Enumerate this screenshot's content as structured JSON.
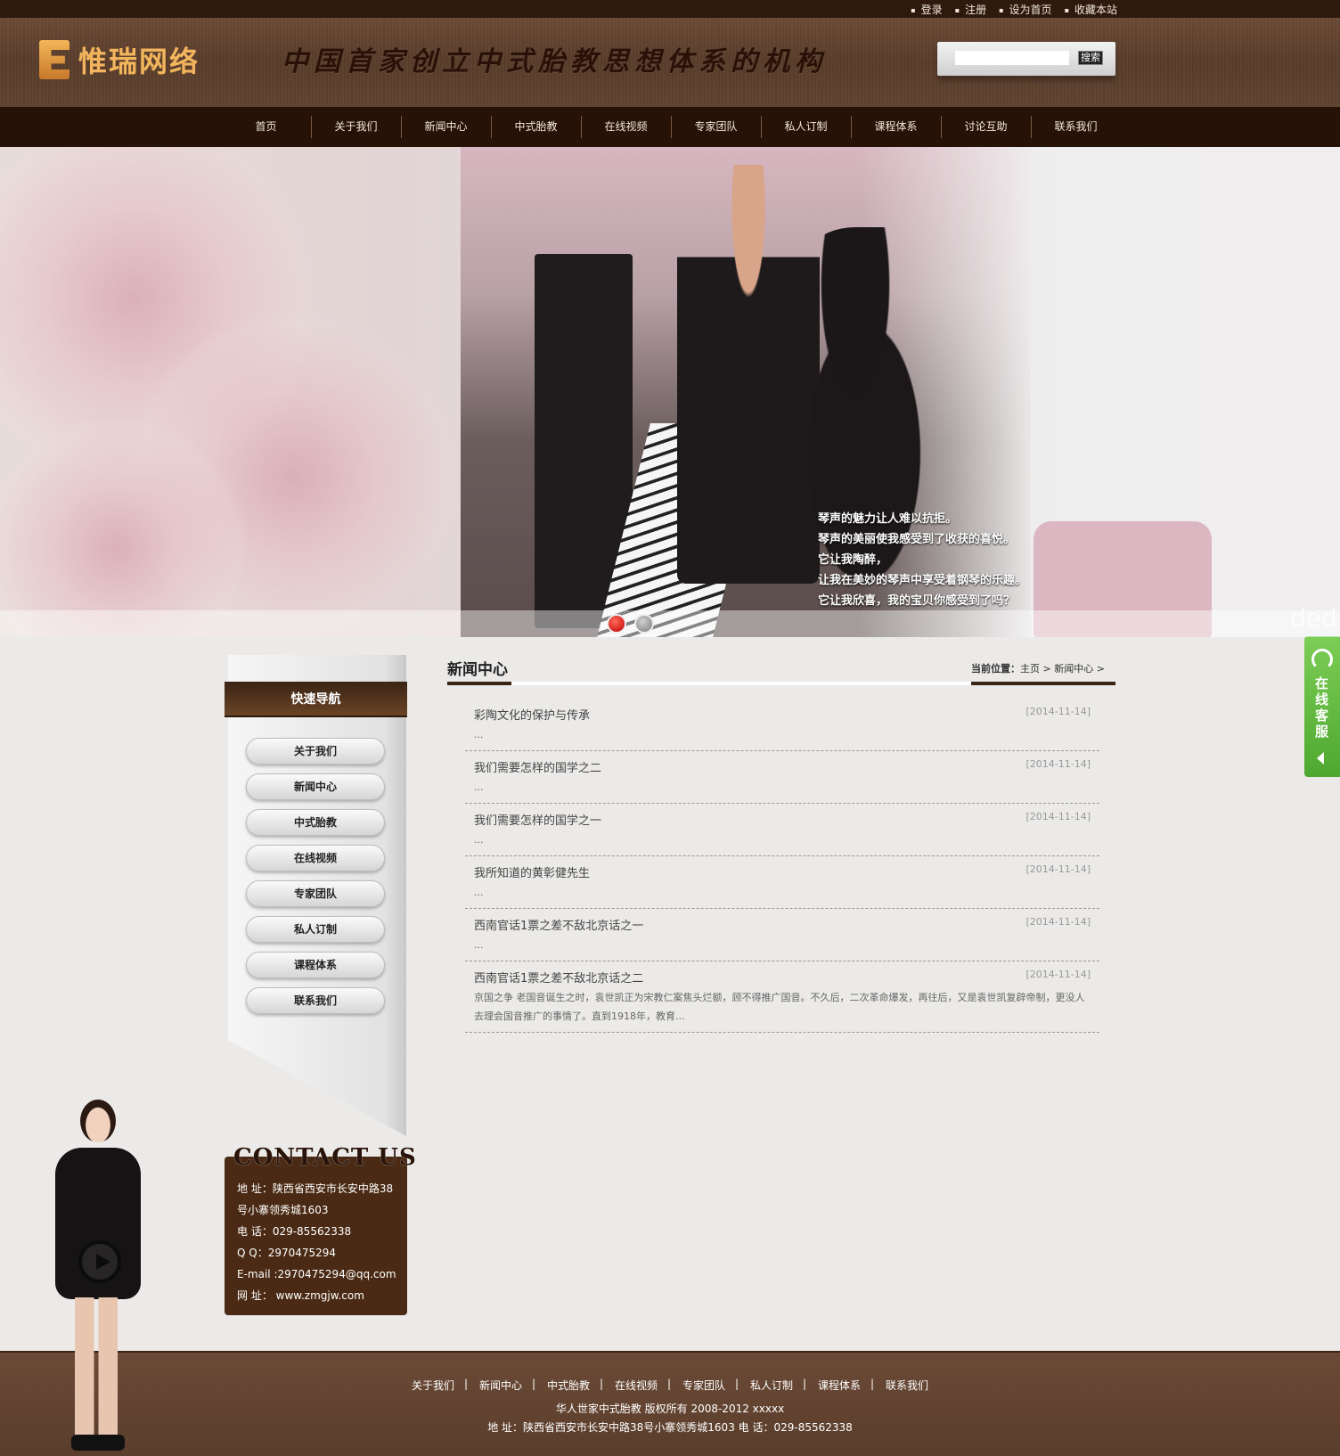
{
  "top_links": [
    "登录",
    "注册",
    "设为首页",
    "收藏本站"
  ],
  "header": {
    "logo_text": "惟瑞网络",
    "slogan": "中国首家创立中式胎教思想体系的机构",
    "search_placeholder": "",
    "search_button": "搜索"
  },
  "nav": [
    "首页",
    "关于我们",
    "新闻中心",
    "中式胎教",
    "在线视频",
    "专家团队",
    "私人订制",
    "课程体系",
    "讨论互助",
    "联系我们"
  ],
  "banner": {
    "caption_lines": [
      "琴声的魅力让人难以抗拒。",
      "琴声的美丽使我感受到了收获的喜悦。",
      "它让我陶醉，",
      "让我在美妙的琴声中享受着钢琴的乐趣。",
      "它让我欣喜，我的宝贝你感受到了吗？"
    ],
    "watermark": "ded",
    "slide_count": 2,
    "active_slide": 1
  },
  "sidebar": {
    "title": "快速导航",
    "items": [
      "关于我们",
      "新闻中心",
      "中式胎教",
      "在线视频",
      "专家团队",
      "私人订制",
      "课程体系",
      "联系我们"
    ]
  },
  "contact": {
    "title": "CONTACT US",
    "lines": [
      "地  址：陕西省西安市长安中路38",
      "号小寨领秀城1603",
      "电  话：029-85562338",
      "Q  Q：2970475294",
      "E-mail :2970475294@qq.com",
      "网  址： www.zmgjw.com"
    ]
  },
  "main": {
    "title": "新闻中心",
    "breadcrumb_label": "当前位置：",
    "breadcrumb_home": "主页",
    "breadcrumb_sep": ">",
    "breadcrumb_current": "新闻中心",
    "breadcrumb_tail": ">"
  },
  "news": [
    {
      "title": "彩陶文化的保护与传承",
      "date": "[2014-11-14]",
      "desc": "..."
    },
    {
      "title": "我们需要怎样的国学之二",
      "date": "[2014-11-14]",
      "desc": "..."
    },
    {
      "title": "我们需要怎样的国学之一",
      "date": "[2014-11-14]",
      "desc": "..."
    },
    {
      "title": "我所知道的黄彰健先生",
      "date": "[2014-11-14]",
      "desc": "..."
    },
    {
      "title": "西南官话1票之差不敌北京话之一",
      "date": "[2014-11-14]",
      "desc": "..."
    },
    {
      "title": "西南官话1票之差不敌北京话之二",
      "date": "[2014-11-14]",
      "desc": "京国之争 老国音诞生之时，袁世凯正为宋教仁案焦头烂额，顾不得推广国音。不久后，二次革命爆发，再往后，又是袁世凯复辟帝制，更没人去理会国音推广的事情了。直到1918年，教育..."
    }
  ],
  "service_tab": {
    "label": "在线客服"
  },
  "footer": {
    "links": [
      "关于我们",
      "新闻中心",
      "中式胎教",
      "在线视频",
      "专家团队",
      "私人订制",
      "课程体系",
      "联系我们"
    ],
    "copyright": "华人世家中式胎教 版权所有 2008-2012 xxxxx",
    "address": "地 址：陕西省西安市长安中路38号小寨领秀城1603 电 话：029-85562338"
  },
  "colors": {
    "nav_bg": "#261207",
    "header_bg": "#5a3d2b",
    "accent_brown": "#3a2414",
    "logo_gold": "#f2b55d",
    "service_green": "#5bb53a"
  }
}
